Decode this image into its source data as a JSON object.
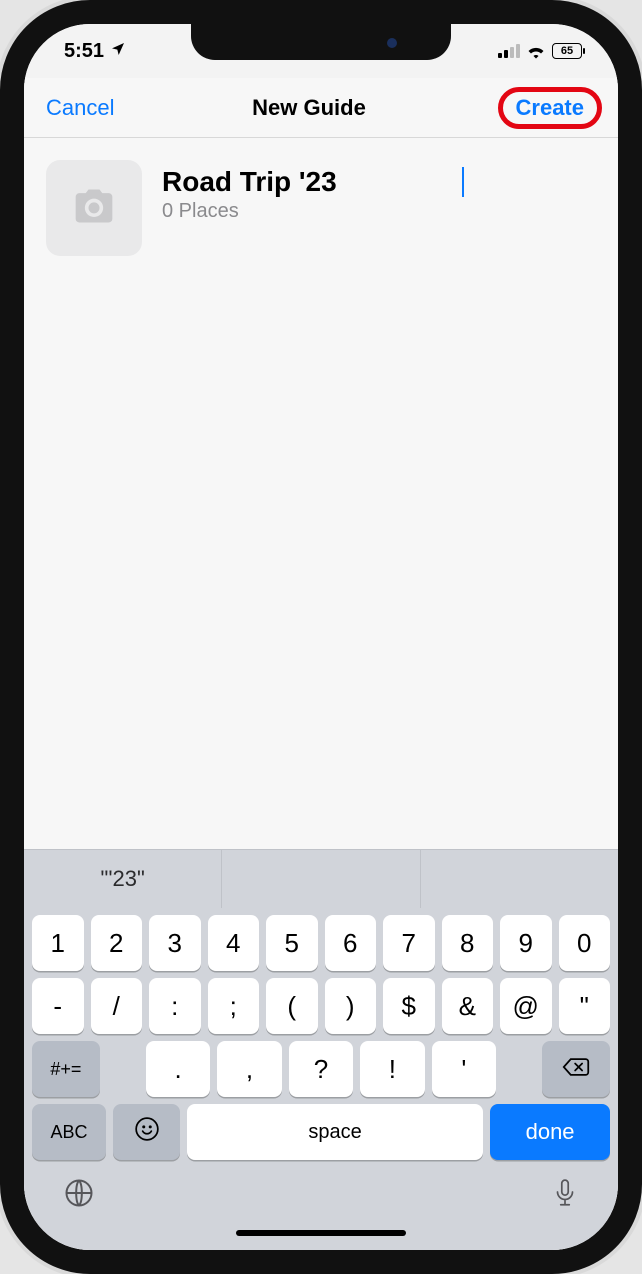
{
  "status": {
    "time": "5:51",
    "battery_percent": "65"
  },
  "nav": {
    "cancel": "Cancel",
    "title": "New Guide",
    "create": "Create"
  },
  "guide": {
    "name": "Road Trip '23",
    "places_subtitle": "0 Places"
  },
  "keyboard": {
    "suggestion1": "\"'23\"",
    "row1": [
      "1",
      "2",
      "3",
      "4",
      "5",
      "6",
      "7",
      "8",
      "9",
      "0"
    ],
    "row2": [
      "-",
      "/",
      ":",
      ";",
      "(",
      ")",
      "$",
      "&",
      "@",
      "\""
    ],
    "row3": [
      ".",
      ",",
      "?",
      "!",
      "'"
    ],
    "symshift": "#+=",
    "abc": "ABC",
    "space": "space",
    "done": "done"
  }
}
